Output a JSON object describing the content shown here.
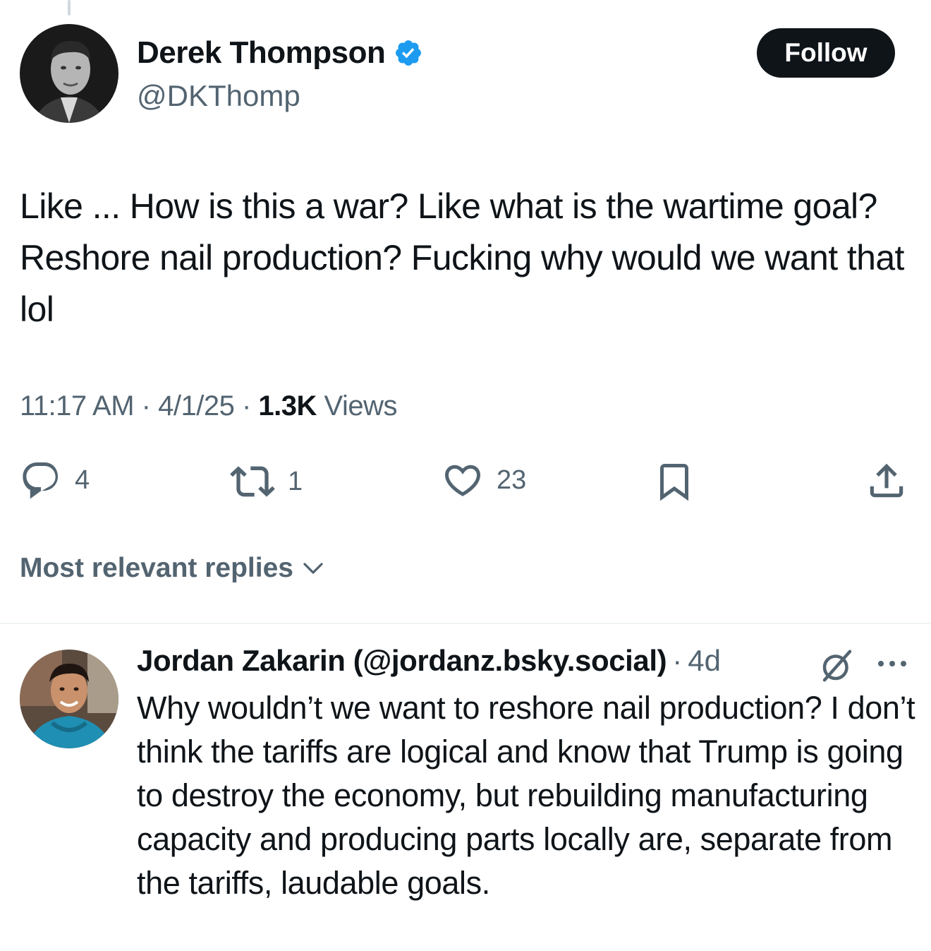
{
  "tweet": {
    "author": {
      "name": "Derek Thompson",
      "handle": "@DKThomp",
      "verified": true,
      "verified_color": "#1d9bf0"
    },
    "follow_label": "Follow",
    "text": "Like ... How is this a war? Like what is the wartime goal? Reshore nail production?  Fucking why would we want that lol",
    "time": "11:17 AM",
    "date": "4/1/25",
    "views_count": "1.3K",
    "views_label": "Views",
    "separator": "·",
    "actions": {
      "replies": "4",
      "reposts": "1",
      "likes": "23",
      "icons": [
        "reply-icon",
        "repost-icon",
        "like-icon",
        "bookmark-icon",
        "share-icon"
      ]
    }
  },
  "replies_sort": {
    "label": "Most relevant replies",
    "icon": "chevron-down-icon"
  },
  "reply": {
    "author": "Jordan Zakarin (@jordanz.bsky.social)",
    "separator": "·",
    "time": "4d",
    "icons": [
      "grok-icon",
      "more-icon"
    ],
    "text": "Why wouldn’t we want to reshore nail production? I don’t think the tariffs are logical and know that Trump is going to destroy the economy, but rebuilding manufacturing capacity and producing parts locally are, separate from the tariffs, laudable goals."
  }
}
